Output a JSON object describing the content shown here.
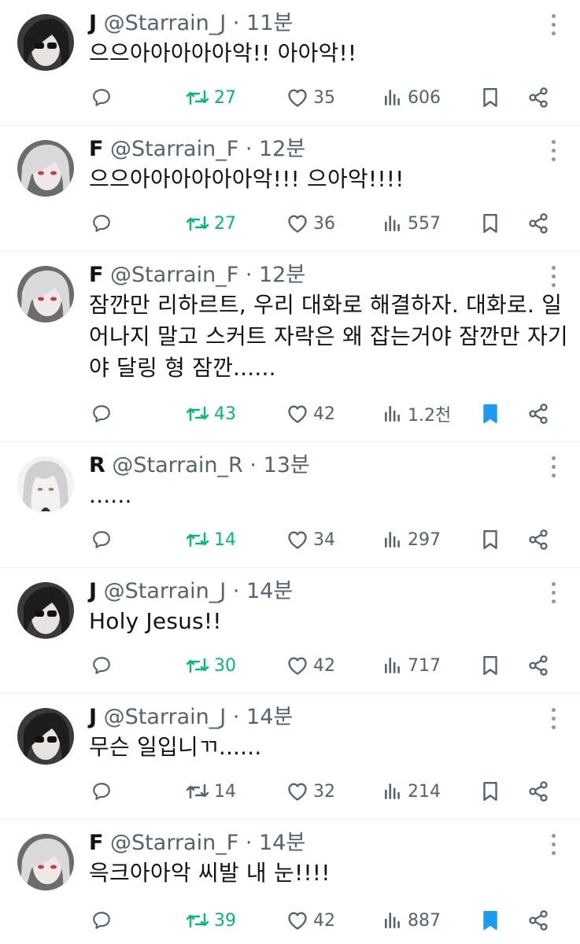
{
  "colors": {
    "text": "#0f1419",
    "secondary": "#536471",
    "retweet_green": "#00ba7c",
    "bookmark_blue": "#1d9bf0",
    "divider": "#eff3f4"
  },
  "tweets": [
    {
      "name": "J",
      "handle": "@Starrain_J",
      "time": "11분",
      "text": "으으아아아아아악!! 아아악!!",
      "replies": "",
      "retweets": "27",
      "likes": "35",
      "views": "606",
      "retweeted": true,
      "bookmarked": false,
      "avatar": "dark-hair-sunglasses"
    },
    {
      "name": "F",
      "handle": "@Starrain_F",
      "time": "12분",
      "text": "으으아아아아아아악!!! 으아악!!!!",
      "replies": "",
      "retweets": "27",
      "likes": "36",
      "views": "557",
      "retweeted": true,
      "bookmarked": false,
      "avatar": "white-hair-red-eyes"
    },
    {
      "name": "F",
      "handle": "@Starrain_F",
      "time": "12분",
      "text": "잠깐만 리하르트, 우리 대화로 해결하자. 대화로. 일어나지 말고 스커트 자락은 왜 잡는거야 잠깐만 자기야 달링 형 잠깐......",
      "replies": "",
      "retweets": "43",
      "likes": "42",
      "views": "1.2천",
      "retweeted": true,
      "bookmarked": true,
      "avatar": "white-hair-red-eyes"
    },
    {
      "name": "R",
      "handle": "@Starrain_R",
      "time": "13분",
      "text": "......",
      "replies": "",
      "retweets": "14",
      "likes": "34",
      "views": "297",
      "retweeted": true,
      "bookmarked": false,
      "avatar": "white-hair-pale"
    },
    {
      "name": "J",
      "handle": "@Starrain_J",
      "time": "14분",
      "text": "Holy Jesus!!",
      "replies": "",
      "retweets": "30",
      "likes": "42",
      "views": "717",
      "retweeted": true,
      "bookmarked": false,
      "avatar": "dark-hair-sunglasses"
    },
    {
      "name": "J",
      "handle": "@Starrain_J",
      "time": "14분",
      "text": "무슨 일입니ㄲ......",
      "replies": "",
      "retweets": "14",
      "likes": "32",
      "views": "214",
      "retweeted": false,
      "bookmarked": false,
      "avatar": "dark-hair-sunglasses"
    },
    {
      "name": "F",
      "handle": "@Starrain_F",
      "time": "14분",
      "text": "윽크아아악 씨발 내 눈!!!!",
      "replies": "",
      "retweets": "39",
      "likes": "42",
      "views": "887",
      "retweeted": true,
      "bookmarked": true,
      "avatar": "white-hair-red-eyes"
    }
  ]
}
